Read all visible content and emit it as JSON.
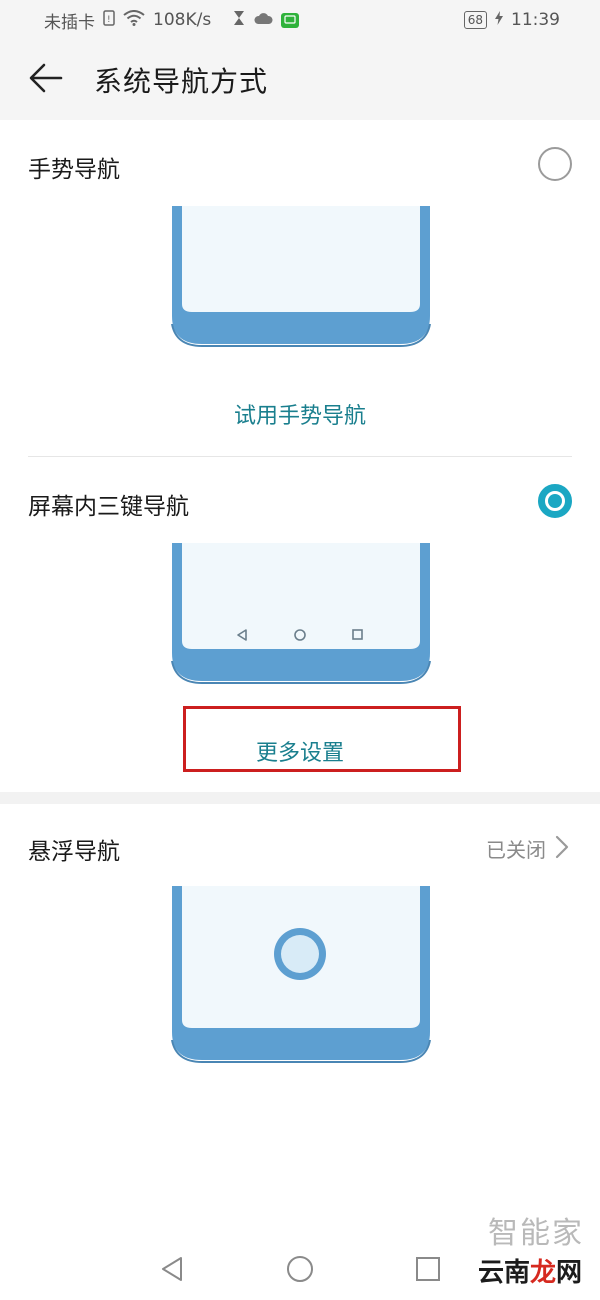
{
  "status_bar": {
    "carrier": "未插卡",
    "speed": "108K/s",
    "battery": "68",
    "time": "11:39"
  },
  "header": {
    "title": "系统导航方式"
  },
  "gesture": {
    "title": "手势导航",
    "selected": false,
    "try_link": "试用手势导航"
  },
  "three_key": {
    "title": "屏幕内三键导航",
    "selected": true,
    "more_settings": "更多设置"
  },
  "floating": {
    "title": "悬浮导航",
    "status": "已关闭"
  },
  "watermark": {
    "line1": "智能家",
    "line2_a": "云南",
    "line2_b": "龙",
    "line2_c": "网"
  },
  "colors": {
    "accent": "#1ba7c3",
    "link": "#1a7f8e",
    "phone_frame": "#5d9fd1",
    "phone_screen": "#f1f8fc",
    "highlight": "#cc1f1f"
  }
}
